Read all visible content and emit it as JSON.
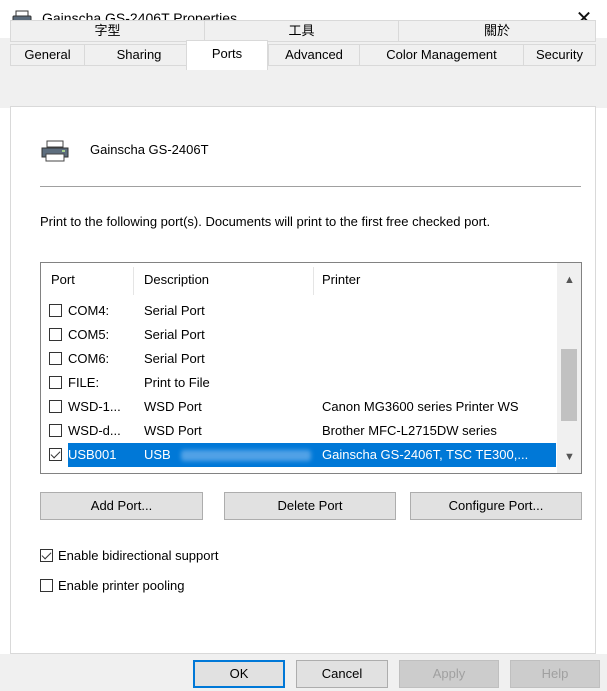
{
  "window": {
    "title": "Gainscha GS-2406T Properties",
    "close_glyph": "✕"
  },
  "tabs_row1": [
    {
      "label": "字型"
    },
    {
      "label": "工具"
    },
    {
      "label": "關於"
    }
  ],
  "tabs_row2": [
    {
      "label": "General"
    },
    {
      "label": "Sharing"
    },
    {
      "label": "Ports",
      "active": true
    },
    {
      "label": "Advanced"
    },
    {
      "label": "Color Management"
    },
    {
      "label": "Security"
    }
  ],
  "printer": {
    "name": "Gainscha GS-2406T",
    "icon": "printer-icon"
  },
  "description": "Print to the following port(s). Documents will print to the first free checked port.",
  "ports_table": {
    "columns": [
      "Port",
      "Description",
      "Printer"
    ],
    "rows": [
      {
        "port": "COM4:",
        "description": "Serial Port",
        "printer": "",
        "checked": false
      },
      {
        "port": "COM5:",
        "description": "Serial Port",
        "printer": "",
        "checked": false
      },
      {
        "port": "COM6:",
        "description": "Serial Port",
        "printer": "",
        "checked": false
      },
      {
        "port": "FILE:",
        "description": "Print to File",
        "printer": "",
        "checked": false
      },
      {
        "port": "WSD-1...",
        "description": "WSD Port",
        "printer": "Canon MG3600 series Printer WS",
        "checked": false
      },
      {
        "port": "WSD-d...",
        "description": "WSD Port",
        "printer": "Brother MFC-L2715DW series",
        "checked": false
      },
      {
        "port": "USB001",
        "description": "USB",
        "printer": "Gainscha GS-2406T, TSC TE300,...",
        "checked": true,
        "selected": true
      }
    ]
  },
  "port_buttons": {
    "add": "Add Port...",
    "delete": "Delete Port",
    "configure": "Configure Port..."
  },
  "options": {
    "bidirectional": {
      "label": "Enable bidirectional support",
      "checked": true
    },
    "pooling": {
      "label": "Enable printer pooling",
      "checked": false
    }
  },
  "footer": {
    "ok": "OK",
    "cancel": "Cancel",
    "apply": "Apply",
    "help": "Help"
  },
  "colors": {
    "selection": "#0078d7",
    "panel": "#f0f0f0",
    "button": "#e1e1e1"
  }
}
